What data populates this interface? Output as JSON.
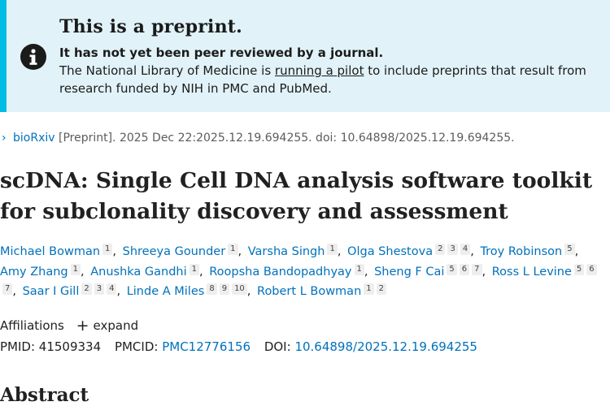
{
  "banner": {
    "title": "This is a preprint.",
    "subtitle": "It has not yet been peer reviewed by a journal.",
    "body_before": "The National Library of Medicine is ",
    "body_link": "running a pilot",
    "body_after": " to include preprints that result from research funded by NIH in PMC and PubMed.",
    "icon": "info-icon",
    "bg_color": "#e1f3f8",
    "accent_color": "#00bde3"
  },
  "citation": {
    "journal": "bioRxiv",
    "details": " [Preprint]. 2025 Dec 22:2025.12.19.694255. doi: 10.64898/2025.12.19.694255."
  },
  "article": {
    "title": "scDNA: Single Cell DNA analysis software toolkit for subclonality discovery and assessment"
  },
  "authors": [
    {
      "name": "Michael Bowman",
      "affs": [
        "1"
      ]
    },
    {
      "name": "Shreeya Gounder",
      "affs": [
        "1"
      ]
    },
    {
      "name": "Varsha Singh",
      "affs": [
        "1"
      ]
    },
    {
      "name": "Olga Shestova",
      "affs": [
        "2",
        "3",
        "4"
      ]
    },
    {
      "name": "Troy Robinson",
      "affs": [
        "5"
      ]
    },
    {
      "name": "Amy Zhang",
      "affs": [
        "1"
      ]
    },
    {
      "name": "Anushka Gandhi",
      "affs": [
        "1"
      ]
    },
    {
      "name": "Roopsha Bandopadhyay",
      "affs": [
        "1"
      ]
    },
    {
      "name": "Sheng F Cai",
      "affs": [
        "5",
        "6",
        "7"
      ]
    },
    {
      "name": "Ross L Levine",
      "affs": [
        "5",
        "6",
        "7"
      ]
    },
    {
      "name": "Saar I Gill",
      "affs": [
        "2",
        "3",
        "4"
      ]
    },
    {
      "name": "Linde A Miles",
      "affs": [
        "8",
        "9",
        "10"
      ]
    },
    {
      "name": "Robert L Bowman",
      "affs": [
        "1",
        "2"
      ]
    }
  ],
  "affiliations": {
    "label": "Affiliations",
    "expand_label": "expand",
    "expand_icon": "plus-icon"
  },
  "ids": {
    "pmid_label": "PMID:",
    "pmid": "41509334",
    "pmcid_label": "PMCID:",
    "pmcid": "PMC12776156",
    "doi_label": "DOI:",
    "doi": "10.64898/2025.12.19.694255"
  },
  "abstract": {
    "heading": "Abstract"
  },
  "colors": {
    "link": "#0071bc",
    "text": "#212121"
  }
}
